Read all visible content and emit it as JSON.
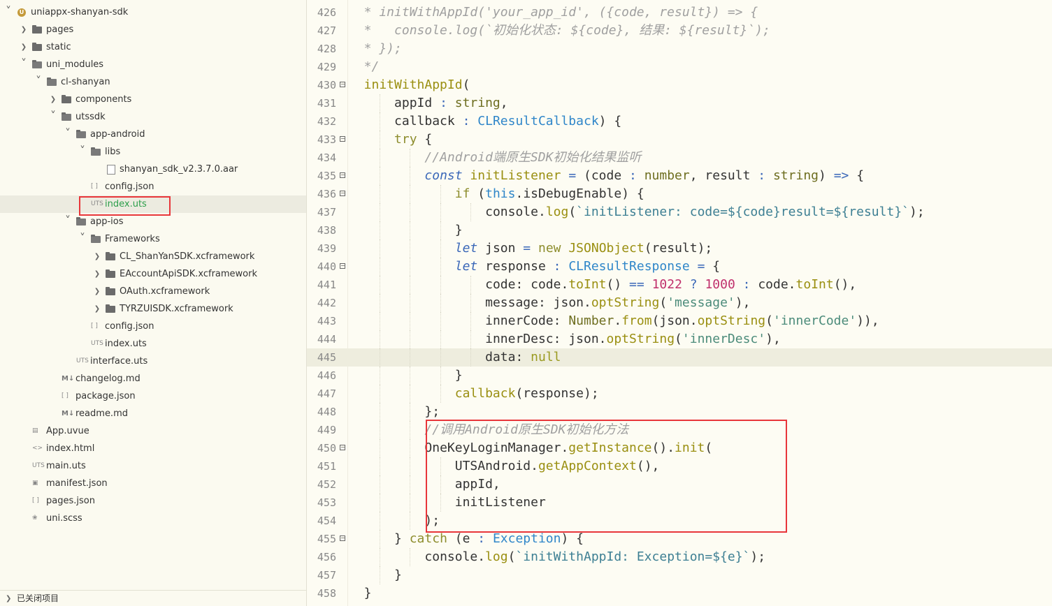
{
  "sidebar": {
    "tree": [
      {
        "label": "uniappx-shanyan-sdk",
        "depth": 0,
        "arrow": "open",
        "icon": "project"
      },
      {
        "label": "pages",
        "depth": 1,
        "arrow": "closed",
        "icon": "folder"
      },
      {
        "label": "static",
        "depth": 1,
        "arrow": "closed",
        "icon": "folder"
      },
      {
        "label": "uni_modules",
        "depth": 1,
        "arrow": "open",
        "icon": "folder-open"
      },
      {
        "label": "cl-shanyan",
        "depth": 2,
        "arrow": "open",
        "icon": "folder-open"
      },
      {
        "label": "components",
        "depth": 3,
        "arrow": "closed",
        "icon": "folder"
      },
      {
        "label": "utssdk",
        "depth": 3,
        "arrow": "open",
        "icon": "folder-open"
      },
      {
        "label": "app-android",
        "depth": 4,
        "arrow": "open",
        "icon": "folder-open"
      },
      {
        "label": "libs",
        "depth": 5,
        "arrow": "open",
        "icon": "folder-open"
      },
      {
        "label": "shanyan_sdk_v2.3.7.0.aar",
        "depth": 6,
        "arrow": "none",
        "icon": "file"
      },
      {
        "label": "config.json",
        "depth": 5,
        "arrow": "none",
        "icon": "json"
      },
      {
        "label": "index.uts",
        "depth": 5,
        "arrow": "none",
        "icon": "uts",
        "selected": true
      },
      {
        "label": "app-ios",
        "depth": 4,
        "arrow": "open",
        "icon": "folder-open"
      },
      {
        "label": "Frameworks",
        "depth": 5,
        "arrow": "open",
        "icon": "folder-open"
      },
      {
        "label": "CL_ShanYanSDK.xcframework",
        "depth": 6,
        "arrow": "closed",
        "icon": "folder"
      },
      {
        "label": "EAccountApiSDK.xcframework",
        "depth": 6,
        "arrow": "closed",
        "icon": "folder"
      },
      {
        "label": "OAuth.xcframework",
        "depth": 6,
        "arrow": "closed",
        "icon": "folder"
      },
      {
        "label": "TYRZUISDK.xcframework",
        "depth": 6,
        "arrow": "closed",
        "icon": "folder"
      },
      {
        "label": "config.json",
        "depth": 5,
        "arrow": "none",
        "icon": "json"
      },
      {
        "label": "index.uts",
        "depth": 5,
        "arrow": "none",
        "icon": "uts"
      },
      {
        "label": "interface.uts",
        "depth": 4,
        "arrow": "none",
        "icon": "uts"
      },
      {
        "label": "changelog.md",
        "depth": 3,
        "arrow": "none",
        "icon": "md"
      },
      {
        "label": "package.json",
        "depth": 3,
        "arrow": "none",
        "icon": "json"
      },
      {
        "label": "readme.md",
        "depth": 3,
        "arrow": "none",
        "icon": "md"
      },
      {
        "label": "App.uvue",
        "depth": 1,
        "arrow": "none",
        "icon": "vue"
      },
      {
        "label": "index.html",
        "depth": 1,
        "arrow": "none",
        "icon": "html"
      },
      {
        "label": "main.uts",
        "depth": 1,
        "arrow": "none",
        "icon": "uts"
      },
      {
        "label": "manifest.json",
        "depth": 1,
        "arrow": "none",
        "icon": "manifest"
      },
      {
        "label": "pages.json",
        "depth": 1,
        "arrow": "none",
        "icon": "json"
      },
      {
        "label": "uni.scss",
        "depth": 1,
        "arrow": "none",
        "icon": "scss"
      }
    ],
    "icon_text": {
      "uts": "UTS",
      "json": "[ ]",
      "md": "M↓",
      "html": "<>",
      "project": "U"
    },
    "closed_projects": "已关闭项目"
  },
  "editor": {
    "current_line": 445,
    "lines": [
      {
        "n": 426,
        "fold": false,
        "indent": 1,
        "tokens": [
          [
            "cm",
            "* initWithAppId('your_app_id', ({code, result}) => {"
          ]
        ]
      },
      {
        "n": 427,
        "fold": false,
        "indent": 1,
        "tokens": [
          [
            "cm",
            "*   console.log(`初始化状态: ${code}, 结果: ${result}`);"
          ]
        ]
      },
      {
        "n": 428,
        "fold": false,
        "indent": 1,
        "tokens": [
          [
            "cm",
            "* });"
          ]
        ]
      },
      {
        "n": 429,
        "fold": false,
        "indent": 1,
        "tokens": [
          [
            "cm",
            "*/"
          ]
        ]
      },
      {
        "n": 430,
        "fold": true,
        "indent": 1,
        "tokens": [
          [
            "fn",
            "initWithAppId"
          ],
          [
            "p",
            "("
          ]
        ]
      },
      {
        "n": 431,
        "fold": false,
        "indent": 2,
        "tokens": [
          [
            "p",
            "appId "
          ],
          [
            "op",
            ":"
          ],
          [
            "p",
            " "
          ],
          [
            "ty",
            "string"
          ],
          [
            "p",
            ","
          ]
        ]
      },
      {
        "n": 432,
        "fold": false,
        "indent": 2,
        "tokens": [
          [
            "p",
            "callback "
          ],
          [
            "op",
            ":"
          ],
          [
            "p",
            " "
          ],
          [
            "cls",
            "CLResultCallback"
          ],
          [
            "p",
            ") {"
          ]
        ]
      },
      {
        "n": 433,
        "fold": true,
        "indent": 2,
        "tokens": [
          [
            "kw",
            "try"
          ],
          [
            "p",
            " {"
          ]
        ]
      },
      {
        "n": 434,
        "fold": false,
        "indent": 3,
        "tokens": [
          [
            "cm",
            "//Android端原生SDK初始化结果监听"
          ]
        ]
      },
      {
        "n": 435,
        "fold": true,
        "indent": 3,
        "tokens": [
          [
            "kwb",
            "const"
          ],
          [
            "p",
            " "
          ],
          [
            "fn",
            "initListener"
          ],
          [
            "p",
            " "
          ],
          [
            "op",
            "="
          ],
          [
            "p",
            " (code "
          ],
          [
            "op",
            ":"
          ],
          [
            "p",
            " "
          ],
          [
            "ty",
            "number"
          ],
          [
            "p",
            ", result "
          ],
          [
            "op",
            ":"
          ],
          [
            "p",
            " "
          ],
          [
            "ty",
            "string"
          ],
          [
            "p",
            ") "
          ],
          [
            "op",
            "=>"
          ],
          [
            "p",
            " {"
          ]
        ]
      },
      {
        "n": 436,
        "fold": true,
        "indent": 4,
        "tokens": [
          [
            "kw",
            "if"
          ],
          [
            "p",
            " ("
          ],
          [
            "ths",
            "this"
          ],
          [
            "p",
            ".isDebugEnable) {"
          ]
        ]
      },
      {
        "n": 437,
        "fold": false,
        "indent": 5,
        "tokens": [
          [
            "p",
            "console."
          ],
          [
            "fn",
            "log"
          ],
          [
            "p",
            "("
          ],
          [
            "tmpl",
            "`initListener: code=${code}result=${result}`"
          ],
          [
            "p",
            ");"
          ]
        ]
      },
      {
        "n": 438,
        "fold": false,
        "indent": 4,
        "tokens": [
          [
            "p",
            "}"
          ]
        ]
      },
      {
        "n": 439,
        "fold": false,
        "indent": 4,
        "tokens": [
          [
            "kwb",
            "let"
          ],
          [
            "p",
            " json "
          ],
          [
            "op",
            "="
          ],
          [
            "p",
            " "
          ],
          [
            "kw",
            "new"
          ],
          [
            "p",
            " "
          ],
          [
            "fn",
            "JSONObject"
          ],
          [
            "p",
            "(result);"
          ]
        ]
      },
      {
        "n": 440,
        "fold": true,
        "indent": 4,
        "tokens": [
          [
            "kwb",
            "let"
          ],
          [
            "p",
            " response "
          ],
          [
            "op",
            ":"
          ],
          [
            "p",
            " "
          ],
          [
            "cls",
            "CLResultResponse"
          ],
          [
            "p",
            " "
          ],
          [
            "op",
            "="
          ],
          [
            "p",
            " {"
          ]
        ]
      },
      {
        "n": 441,
        "fold": false,
        "indent": 5,
        "tokens": [
          [
            "p",
            "code: code."
          ],
          [
            "fn",
            "toInt"
          ],
          [
            "p",
            "() "
          ],
          [
            "op",
            "=="
          ],
          [
            "p",
            " "
          ],
          [
            "num",
            "1022"
          ],
          [
            "p",
            " "
          ],
          [
            "op",
            "?"
          ],
          [
            "p",
            " "
          ],
          [
            "num",
            "1000"
          ],
          [
            "p",
            " "
          ],
          [
            "op",
            ":"
          ],
          [
            "p",
            " code."
          ],
          [
            "fn",
            "toInt"
          ],
          [
            "p",
            "(),"
          ]
        ]
      },
      {
        "n": 442,
        "fold": false,
        "indent": 5,
        "tokens": [
          [
            "p",
            "message: json."
          ],
          [
            "fn",
            "optString"
          ],
          [
            "p",
            "("
          ],
          [
            "str",
            "'message'"
          ],
          [
            "p",
            "),"
          ]
        ]
      },
      {
        "n": 443,
        "fold": false,
        "indent": 5,
        "tokens": [
          [
            "p",
            "innerCode: "
          ],
          [
            "ty",
            "Number"
          ],
          [
            "p",
            "."
          ],
          [
            "fn",
            "from"
          ],
          [
            "p",
            "(json."
          ],
          [
            "fn",
            "optString"
          ],
          [
            "p",
            "("
          ],
          [
            "str",
            "'innerCode'"
          ],
          [
            "p",
            ")),"
          ]
        ]
      },
      {
        "n": 444,
        "fold": false,
        "indent": 5,
        "tokens": [
          [
            "p",
            "innerDesc: json."
          ],
          [
            "fn",
            "optString"
          ],
          [
            "p",
            "("
          ],
          [
            "str",
            "'innerDesc'"
          ],
          [
            "p",
            "),"
          ]
        ]
      },
      {
        "n": 445,
        "fold": false,
        "indent": 5,
        "tokens": [
          [
            "p",
            "data: "
          ],
          [
            "nul",
            "null"
          ]
        ]
      },
      {
        "n": 446,
        "fold": false,
        "indent": 4,
        "tokens": [
          [
            "p",
            "}"
          ]
        ]
      },
      {
        "n": 447,
        "fold": false,
        "indent": 4,
        "tokens": [
          [
            "fn",
            "callback"
          ],
          [
            "p",
            "(response);"
          ]
        ]
      },
      {
        "n": 448,
        "fold": false,
        "indent": 3,
        "tokens": [
          [
            "p",
            "};"
          ]
        ]
      },
      {
        "n": 449,
        "fold": false,
        "indent": 3,
        "tokens": [
          [
            "cm",
            "//调用Android原生SDK初始化方法"
          ]
        ]
      },
      {
        "n": 450,
        "fold": true,
        "indent": 3,
        "tokens": [
          [
            "p",
            "OneKeyLoginManager."
          ],
          [
            "fn",
            "getInstance"
          ],
          [
            "p",
            "()."
          ],
          [
            "fn",
            "init"
          ],
          [
            "p",
            "("
          ]
        ]
      },
      {
        "n": 451,
        "fold": false,
        "indent": 4,
        "tokens": [
          [
            "p",
            "UTSAndroid."
          ],
          [
            "fn",
            "getAppContext"
          ],
          [
            "p",
            "(),"
          ]
        ]
      },
      {
        "n": 452,
        "fold": false,
        "indent": 4,
        "tokens": [
          [
            "p",
            "appId,"
          ]
        ]
      },
      {
        "n": 453,
        "fold": false,
        "indent": 4,
        "tokens": [
          [
            "p",
            "initListener"
          ]
        ]
      },
      {
        "n": 454,
        "fold": false,
        "indent": 3,
        "tokens": [
          [
            "p",
            ");"
          ]
        ]
      },
      {
        "n": 455,
        "fold": true,
        "indent": 2,
        "tokens": [
          [
            "p",
            "} "
          ],
          [
            "kw",
            "catch"
          ],
          [
            "p",
            " (e "
          ],
          [
            "op",
            ":"
          ],
          [
            "p",
            " "
          ],
          [
            "cls",
            "Exception"
          ],
          [
            "p",
            ") {"
          ]
        ]
      },
      {
        "n": 456,
        "fold": false,
        "indent": 3,
        "tokens": [
          [
            "p",
            "console."
          ],
          [
            "fn",
            "log"
          ],
          [
            "p",
            "("
          ],
          [
            "tmpl",
            "`initWithAppId: Exception=${e}`"
          ],
          [
            "p",
            ");"
          ]
        ]
      },
      {
        "n": 457,
        "fold": false,
        "indent": 2,
        "tokens": [
          [
            "p",
            "}"
          ]
        ]
      },
      {
        "n": 458,
        "fold": false,
        "indent": 1,
        "tokens": [
          [
            "p",
            "}"
          ]
        ]
      }
    ]
  },
  "colors": {
    "highlight": "#e8363a",
    "selected_text": "#2b9e4a",
    "background": "#fdfcf3"
  }
}
